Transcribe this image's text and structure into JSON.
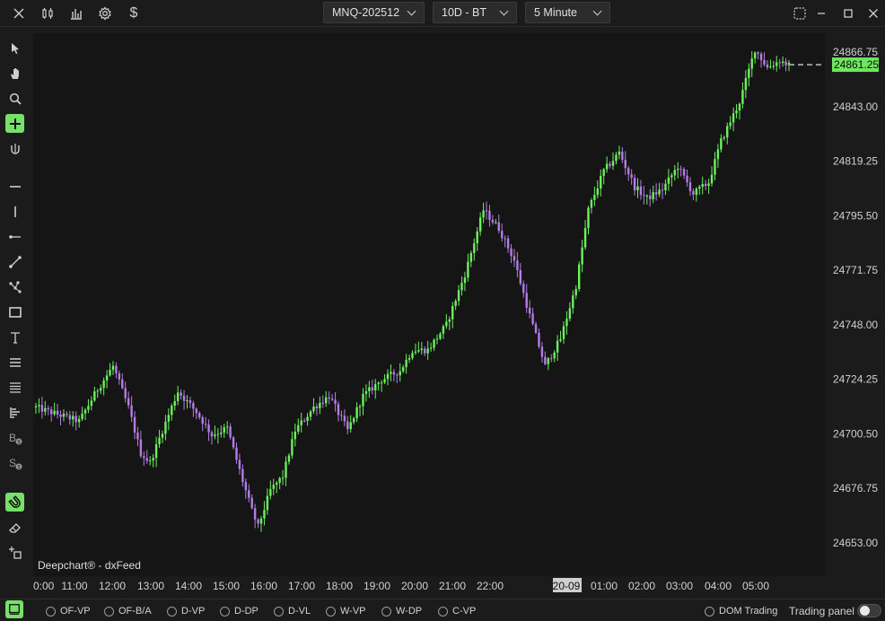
{
  "header": {
    "symbol": "MNQ-202512",
    "range": "10D - BT",
    "interval": "5 Minute"
  },
  "watermark": "Deepchart® - dxFeed",
  "price_axis": {
    "ticks": [
      "24866.75",
      "24843.00",
      "24819.25",
      "24795.50",
      "24771.75",
      "24748.00",
      "24724.25",
      "24700.50",
      "24676.75",
      "24653.00"
    ],
    "last_price": "24861.25"
  },
  "time_axis": {
    "ticks": [
      "0:00",
      "11:00",
      "12:00",
      "13:00",
      "14:00",
      "15:00",
      "16:00",
      "17:00",
      "18:00",
      "19:00",
      "20:00",
      "21:00",
      "22:00",
      "20-09",
      "01:00",
      "02:00",
      "03:00",
      "04:00",
      "05:00"
    ]
  },
  "bottom": {
    "indicators": [
      "OF-VP",
      "OF-B/A",
      "D-VP",
      "D-DP",
      "D-VL",
      "W-VP",
      "W-DP",
      "C-VP"
    ],
    "dom_trading": "DOM Trading",
    "trading_panel": "Trading panel"
  },
  "colors": {
    "up": "#6cf05e",
    "down": "#b47ce6",
    "accent": "#7be06c",
    "background": "#151515"
  },
  "chart_data": {
    "type": "candlestick",
    "ylim": [
      24653.0,
      24880.0
    ],
    "anchors": [
      [
        0,
        24712
      ],
      [
        14,
        24706
      ],
      [
        20,
        24720
      ],
      [
        25,
        24730
      ],
      [
        30,
        24712
      ],
      [
        34,
        24692
      ],
      [
        37,
        24688
      ],
      [
        41,
        24702
      ],
      [
        46,
        24719
      ],
      [
        52,
        24710
      ],
      [
        57,
        24700
      ],
      [
        62,
        24703
      ],
      [
        67,
        24680
      ],
      [
        70,
        24667
      ],
      [
        72,
        24660
      ],
      [
        76,
        24676
      ],
      [
        80,
        24682
      ],
      [
        84,
        24702
      ],
      [
        90,
        24712
      ],
      [
        95,
        24717
      ],
      [
        101,
        24702
      ],
      [
        106,
        24717
      ],
      [
        112,
        24724
      ],
      [
        118,
        24728
      ],
      [
        122,
        24737
      ],
      [
        127,
        24737
      ],
      [
        133,
        24748
      ],
      [
        139,
        24770
      ],
      [
        145,
        24798
      ],
      [
        150,
        24790
      ],
      [
        155,
        24776
      ],
      [
        160,
        24752
      ],
      [
        165,
        24730
      ],
      [
        170,
        24742
      ],
      [
        175,
        24765
      ],
      [
        179,
        24798
      ],
      [
        184,
        24815
      ],
      [
        189,
        24823
      ],
      [
        194,
        24808
      ],
      [
        198,
        24803
      ],
      [
        203,
        24807
      ],
      [
        208,
        24817
      ],
      [
        213,
        24805
      ],
      [
        218,
        24810
      ],
      [
        222,
        24828
      ],
      [
        228,
        24845
      ],
      [
        233,
        24868
      ],
      [
        237,
        24860
      ],
      [
        241,
        24863
      ],
      [
        244,
        24861
      ]
    ]
  }
}
